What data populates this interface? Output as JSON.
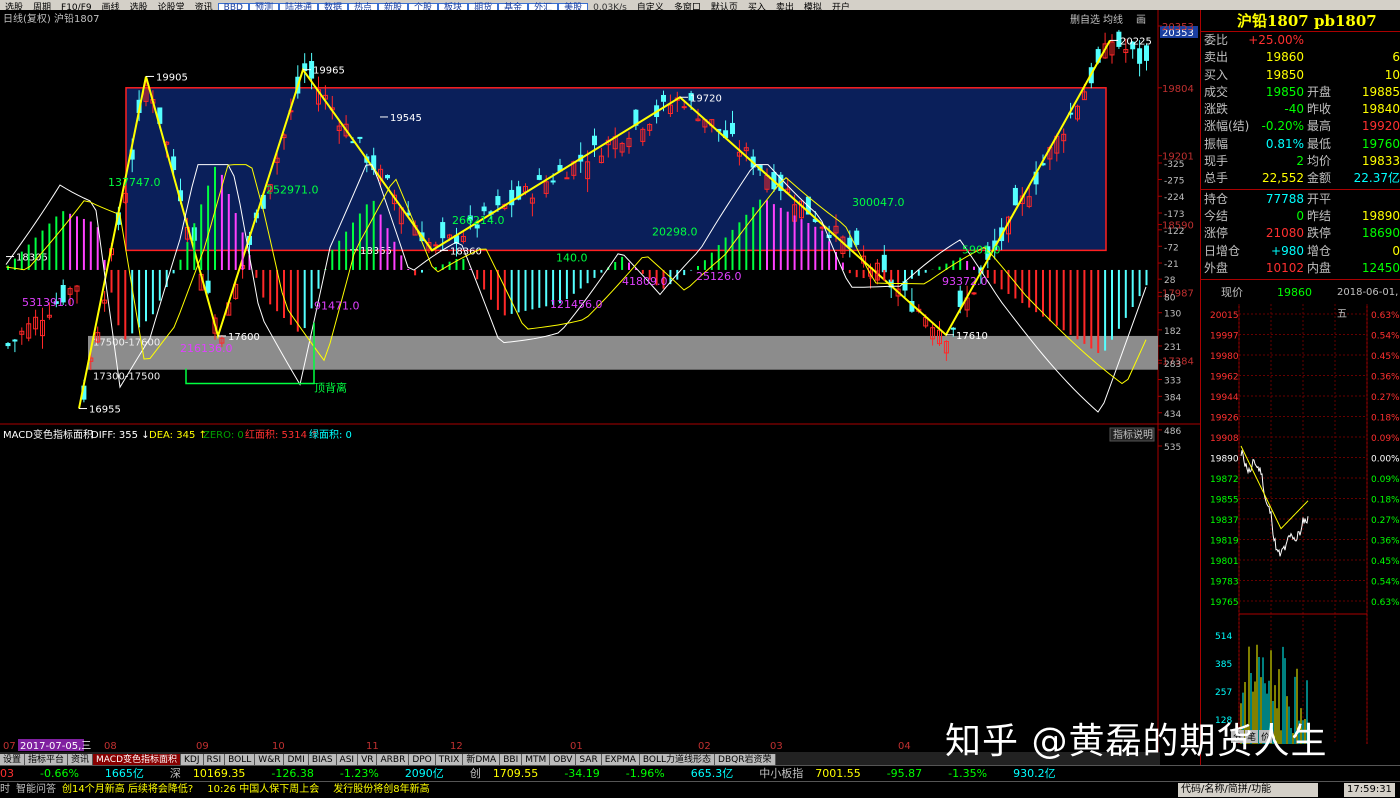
{
  "menubar": {
    "items": [
      "选股",
      "周期",
      "F10/F9",
      "画线",
      "选股",
      "论股堂",
      "资讯"
    ],
    "buttons": [
      "BBD",
      "预测",
      "陆港通",
      "数据",
      "热点",
      "新股",
      "个股",
      "板块",
      "期货",
      "基金",
      "外汇",
      "美股"
    ],
    "right_items": [
      "自定义",
      "多窗口",
      "默认页",
      "买入",
      "卖出",
      "模拟",
      "开户"
    ],
    "speed": "0.03K/s"
  },
  "chart_header": {
    "left": "日线(复权) 沪铅1807",
    "right_buttons": [
      "删自选",
      "均线",
      "画"
    ],
    "price_tag": "20353"
  },
  "chart_data": [
    {
      "type": "candlestick",
      "title": "日线(复权) 沪铅1807",
      "y_ticks": [
        20353,
        19804,
        19201,
        18590,
        17987,
        17384
      ],
      "ylim": [
        16800,
        20353
      ],
      "zone_box": {
        "low": 18360,
        "high": 19804
      },
      "support_band": {
        "low": 17300,
        "high": 17600
      },
      "annotations": [
        {
          "label": "18305",
          "value": 18305
        },
        {
          "label": "16955",
          "value": 16955
        },
        {
          "label": "19905",
          "value": 19905
        },
        {
          "label": "17600",
          "value": 17600
        },
        {
          "label": "19965",
          "value": 19965
        },
        {
          "label": "19545",
          "value": 19545
        },
        {
          "label": "18365",
          "value": 18365
        },
        {
          "label": "18360",
          "value": 18360
        },
        {
          "label": "19720",
          "value": 19720
        },
        {
          "label": "17610",
          "value": 17610
        },
        {
          "label": "20225",
          "value": 20225
        }
      ],
      "band_labels": [
        "17500-17600",
        "17300-17500"
      ],
      "zigzag": [
        16955,
        19905,
        17600,
        19965,
        18360,
        19720,
        17610,
        20225
      ]
    },
    {
      "type": "bar",
      "title": "MACD变色指标面积",
      "indicator_header": {
        "diff": "DIFF: 355",
        "dea": "DEA: 345",
        "zero": "ZERO: 0",
        "red": "红面积: 5314",
        "green": "绿面积: 0"
      },
      "help_button": "指标说明",
      "y_ticks": [
        535,
        486,
        434,
        384,
        333,
        283,
        231,
        182,
        130,
        80,
        28,
        -21,
        -72,
        -122,
        -173,
        -224,
        -275,
        -325
      ],
      "ylim": [
        -340,
        560
      ],
      "area_labels": [
        "531391.0",
        "216136.0",
        "91471.0",
        "121456.0",
        "41809.0",
        "25126.0",
        "93372.0",
        "137747.0",
        "252971.0",
        "266214.0",
        "140.0",
        "20298.0",
        "300047.0",
        "5901.0"
      ],
      "divergence_label": "顶背离",
      "x_ticks": [
        "07",
        "2017-07-05,三",
        "08",
        "09",
        "10",
        "11",
        "12",
        "01",
        "02",
        "03",
        "04"
      ]
    }
  ],
  "bottom_tabs": [
    "设置",
    "指标平台",
    "资讯",
    "MACD变色指标面积",
    "KDJ",
    "RSI",
    "BOLL",
    "W&R",
    "DMI",
    "BIAS",
    "ASI",
    "VR",
    "ARBR",
    "DPO",
    "TRIX",
    "新DMA",
    "BBI",
    "MTM",
    "OBV",
    "SAR",
    "EXPMA",
    "BOLL力道线形态",
    "DBQR岩资荣"
  ],
  "right_panel": {
    "title": "沪铅1807 pb1807",
    "rows": [
      {
        "l1": "委比",
        "v1": "+25.00%",
        "c1": "#ff3030",
        "l2": "",
        "v2": "",
        "c2": "#ff3030"
      },
      {
        "l1": "卖出",
        "v1": "19860",
        "c1": "#ffff00",
        "l2": "",
        "v2": "6",
        "c2": "#ffff00"
      },
      {
        "l1": "买入",
        "v1": "19850",
        "c1": "#ffff00",
        "l2": "",
        "v2": "10",
        "c2": "#ffff00"
      },
      {
        "l1": "成交",
        "v1": "19850",
        "c1": "#00ff00",
        "l2": "开盘",
        "v2": "19885",
        "c2": "#ffff00"
      },
      {
        "l1": "涨跌",
        "v1": "-40",
        "c1": "#00ff00",
        "l2": "昨收",
        "v2": "19840",
        "c2": "#ffff00"
      },
      {
        "l1": "涨幅(结)",
        "v1": "-0.20%",
        "c1": "#00ff00",
        "l2": "最高",
        "v2": "19920",
        "c2": "#ff3030"
      },
      {
        "l1": "振幅",
        "v1": "0.81%",
        "c1": "#00ffff",
        "l2": "最低",
        "v2": "19760",
        "c2": "#00ff00"
      },
      {
        "l1": "现手",
        "v1": "2",
        "c1": "#00ff00",
        "l2": "均价",
        "v2": "19833",
        "c2": "#ffff00"
      },
      {
        "l1": "总手",
        "v1": "22,552",
        "c1": "#ffff00",
        "l2": "金额",
        "v2": "22.37亿",
        "c2": "#00ffff"
      },
      {
        "l1": "持仓",
        "v1": "77788",
        "c1": "#00ffff",
        "l2": "开平",
        "v2": "",
        "c2": "#ffff00"
      },
      {
        "l1": "今结",
        "v1": "0",
        "c1": "#00ff00",
        "l2": "昨结",
        "v2": "19890",
        "c2": "#ffff00"
      },
      {
        "l1": "涨停",
        "v1": "21080",
        "c1": "#ff3030",
        "l2": "跌停",
        "v2": "18690",
        "c2": "#00ff00"
      },
      {
        "l1": "日增仓",
        "v1": "+980",
        "c1": "#00ffff",
        "l2": "增仓",
        "v2": "0",
        "c2": "#ffff00"
      },
      {
        "l1": "外盘",
        "v1": "10102",
        "c1": "#ff3030",
        "l2": "内盘",
        "v2": "12450",
        "c2": "#00ff00"
      }
    ],
    "now_label": "现价",
    "now_value": "19860",
    "now_date": "2018-06-01,五",
    "intraday_left_ticks": [
      "20015",
      "19997",
      "19980",
      "19962",
      "19944",
      "19926",
      "19908",
      "19890",
      "19872",
      "19855",
      "19837",
      "19819",
      "19801",
      "19783",
      "19765"
    ],
    "intraday_right_ticks": [
      "0.63%",
      "0.54%",
      "0.45%",
      "0.36%",
      "0.27%",
      "0.18%",
      "0.09%",
      "0.00%",
      "0.09%",
      "0.18%",
      "0.27%",
      "0.36%",
      "0.45%",
      "0.54%",
      "0.63%"
    ],
    "volume_ticks": [
      "514",
      "385",
      "257",
      "128"
    ],
    "side_tabs": [
      "分",
      "笔",
      "价"
    ]
  },
  "ticker": [
    {
      "t": "03",
      "c": "#ff3030"
    },
    {
      "t": "-0.66%",
      "c": "#00ff00"
    },
    {
      "t": "1665亿",
      "c": "#00ffff"
    },
    {
      "t": "深",
      "c": "#c0c0c0"
    },
    {
      "t": "10169.35",
      "c": "#ffff00"
    },
    {
      "t": "-126.38",
      "c": "#00ff00"
    },
    {
      "t": "-1.23%",
      "c": "#00ff00"
    },
    {
      "t": "2090亿",
      "c": "#00ffff"
    },
    {
      "t": "创",
      "c": "#c0c0c0"
    },
    {
      "t": "1709.55",
      "c": "#ffff00"
    },
    {
      "t": "-34.19",
      "c": "#00ff00"
    },
    {
      "t": "-1.96%",
      "c": "#00ff00"
    },
    {
      "t": "665.3亿",
      "c": "#00ffff"
    },
    {
      "t": "中小板指",
      "c": "#c0c0c0"
    },
    {
      "t": "7001.55",
      "c": "#ffff00"
    },
    {
      "t": "-95.87",
      "c": "#00ff00"
    },
    {
      "t": "-1.35%",
      "c": "#00ff00"
    },
    {
      "t": "930.2亿",
      "c": "#00ffff"
    }
  ],
  "news": {
    "prefix": "时",
    "button": "智能问答",
    "items": [
      "创14个月新高 后续将会降低?",
      "10:26 中国人保下周上会",
      "发行股份将创8年新高"
    ],
    "search_placeholder": "代码/名称/简拼/功能",
    "clock": "17:59:31"
  },
  "watermark": "知乎 @黄磊的期货人生",
  "colors": {
    "up": "#ff2828",
    "down": "#54ffff",
    "zig": "#ffff00",
    "box": "#0a1f5a",
    "boxborder": "#ff2020"
  }
}
